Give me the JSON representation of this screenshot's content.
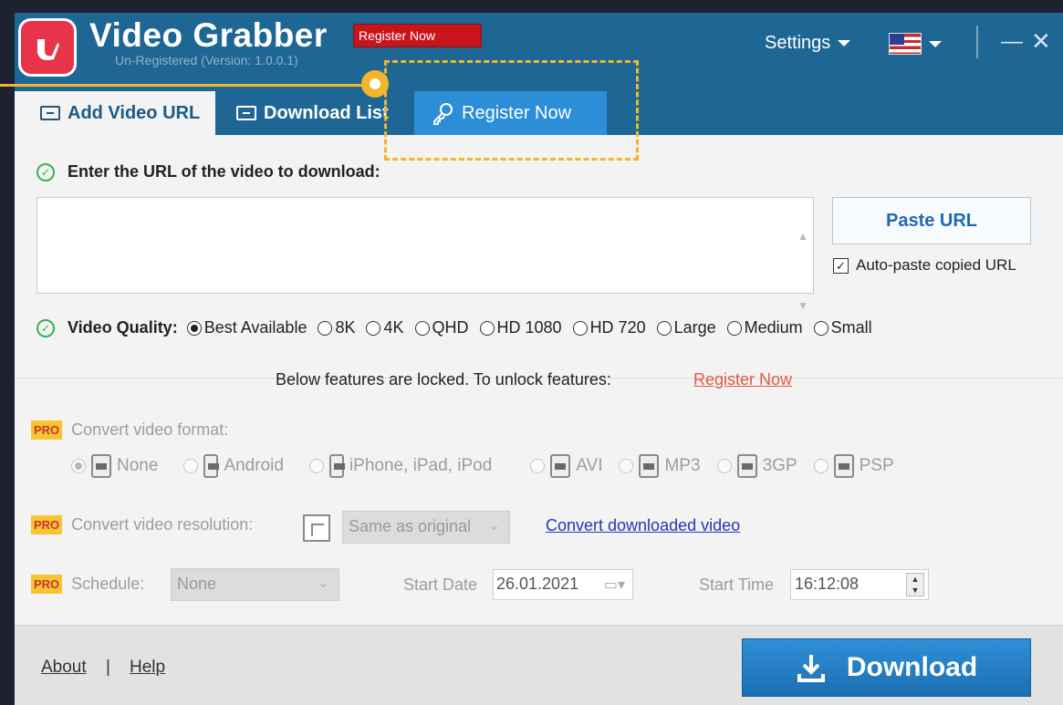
{
  "header": {
    "title": "Video Grabber",
    "subtitle": "Un-Registered (Version: 1.0.0.1)",
    "register_badge": "Register Now",
    "settings": "Settings"
  },
  "tabs": [
    {
      "label": "Add Video URL"
    },
    {
      "label": "Download List"
    },
    {
      "label": "Register Now"
    }
  ],
  "url_section": {
    "label": "Enter the URL of the video to download:",
    "value": "",
    "paste_button": "Paste URL",
    "auto_paste_label": "Auto-paste copied URL",
    "auto_paste_checked": true
  },
  "quality": {
    "label": "Video Quality:",
    "selected": "Best Available",
    "options": [
      "Best Available",
      "8K",
      "4K",
      "QHD",
      "HD 1080",
      "HD 720",
      "Large",
      "Medium",
      "Small"
    ]
  },
  "locked_notice": {
    "text": "Below features are locked. To unlock features:",
    "link": "Register Now"
  },
  "pro_badge": "PRO",
  "convert_format": {
    "label": "Convert video format:",
    "selected": "None",
    "options": [
      "None",
      "Android",
      "iPhone, iPad, iPod",
      "AVI",
      "MP3",
      "3GP",
      "PSP"
    ]
  },
  "convert_resolution": {
    "label": "Convert video resolution:",
    "value": "Same as original",
    "link": "Convert downloaded video"
  },
  "schedule": {
    "label": "Schedule:",
    "value": "None",
    "start_date_label": "Start Date",
    "start_date": "26.01.2021",
    "start_time_label": "Start Time",
    "start_time": "16:12:08"
  },
  "footer": {
    "about": "About",
    "separator": "|",
    "help": "Help",
    "download": "Download"
  },
  "colors": {
    "header_bg": "#1e6795",
    "accent_tab": "#2b8ed6",
    "callout": "#f2b52c",
    "pro_bg": "#f7c531",
    "register_link": "#e35a40"
  }
}
